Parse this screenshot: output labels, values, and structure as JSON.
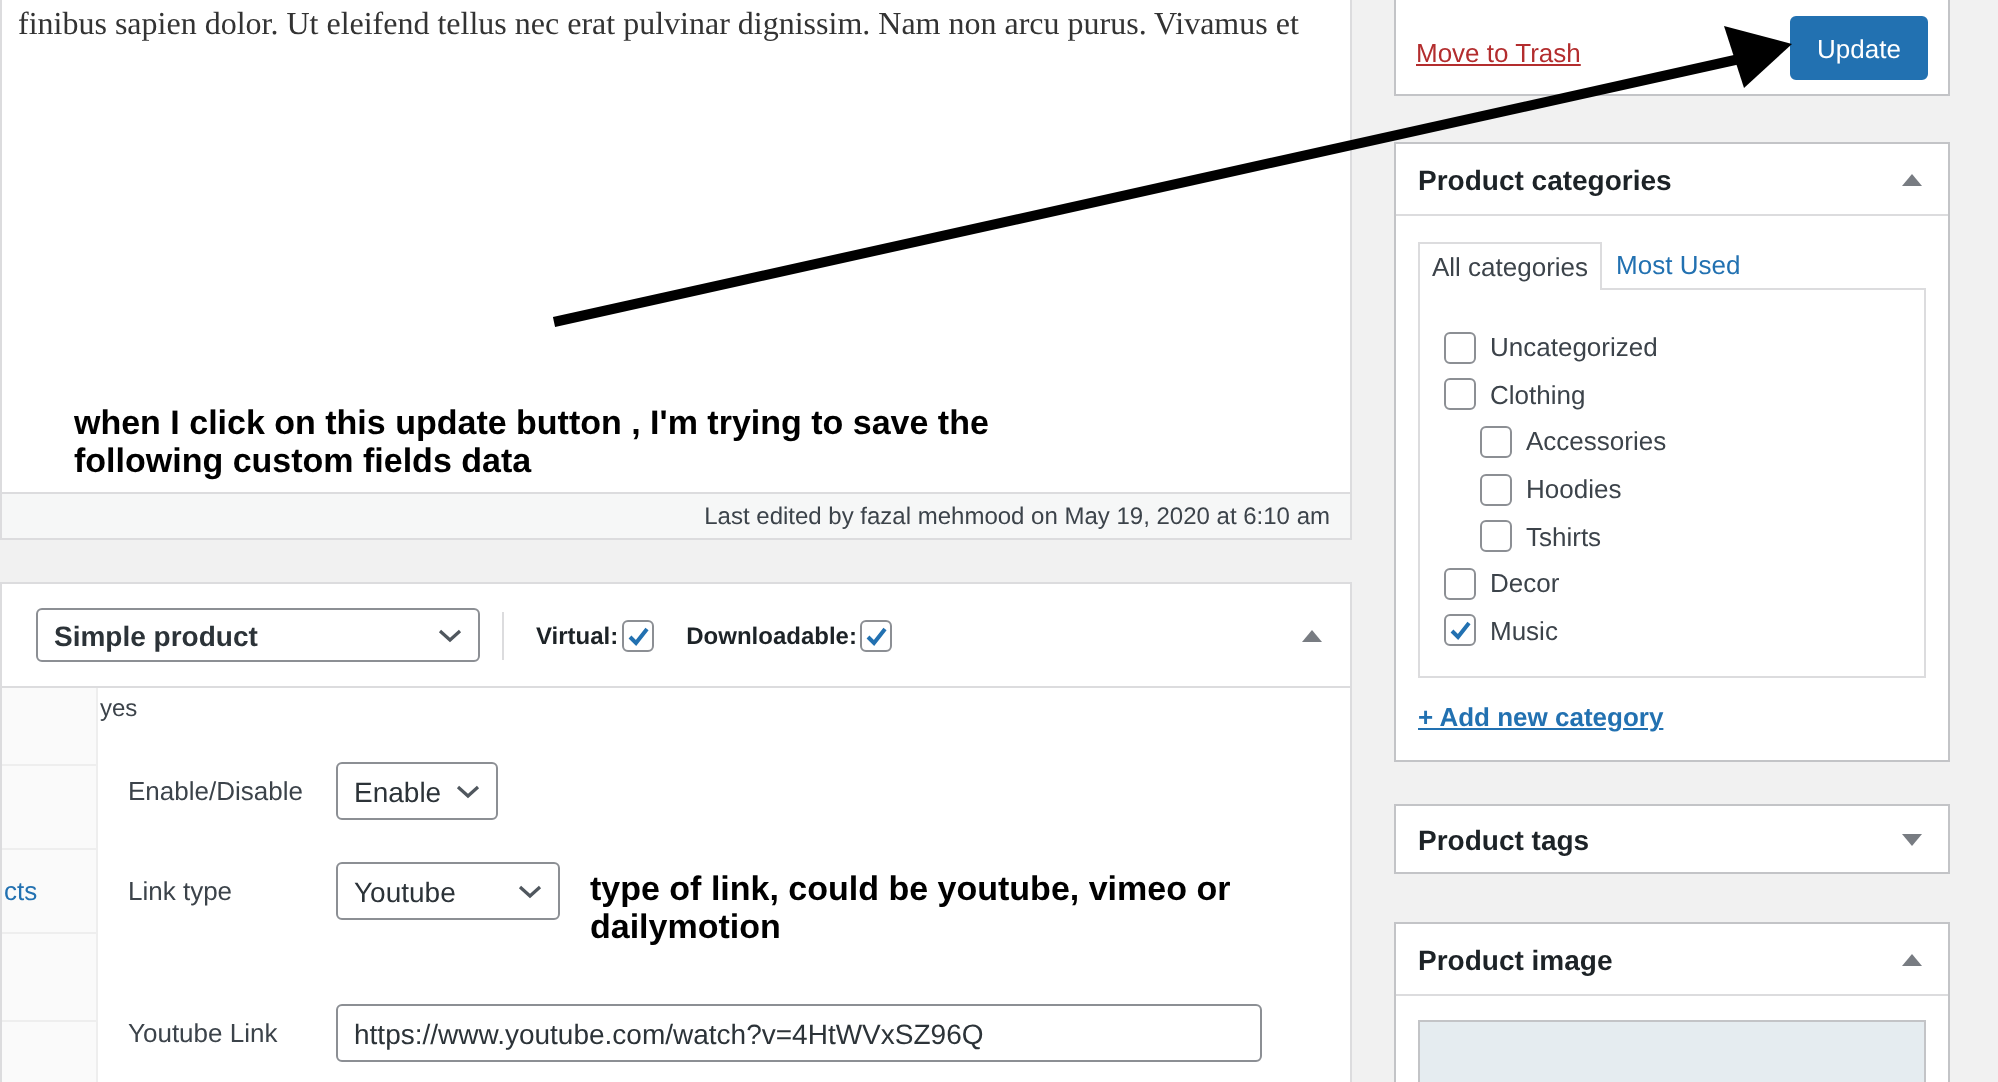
{
  "editor": {
    "text": "finibus sapien dolor. Ut eleifend tellus nec erat pulvinar dignissim. Nam non arcu purus. Vivamus et",
    "last_edited": "Last edited by fazal mehmood on May 19, 2020 at 6:10 am"
  },
  "annotations": [
    {
      "text": "when I click on this update button , I'm trying to save the following custom fields data"
    },
    {
      "text": "type of link, could be youtube, vimeo or dailymotion"
    }
  ],
  "product_data": {
    "type_select": "Simple product",
    "expanded": true,
    "options": [
      {
        "label": "Virtual:",
        "checked": true
      },
      {
        "label": "Downloadable:",
        "checked": true
      }
    ],
    "sidebar_tabs": [
      {
        "label": "cts"
      }
    ],
    "value_text": "yes",
    "fields": [
      {
        "kind": "select",
        "label": "Enable/Disable",
        "value": "Enable"
      },
      {
        "kind": "select",
        "label": "Link type",
        "value": "Youtube"
      },
      {
        "kind": "text",
        "label": "Youtube Link",
        "value": "https://www.youtube.com/watch?v=4HtWVxSZ96Q"
      }
    ]
  },
  "sidebar": {
    "publish": {
      "links": [
        {
          "kind": "trash",
          "label": "Move to Trash"
        }
      ],
      "button": "Update"
    },
    "categories": {
      "title": "Product categories",
      "expanded": true,
      "tabs": [
        {
          "label": "All categories",
          "selected": true
        },
        {
          "label": "Most Used",
          "selected": false
        }
      ],
      "items": [
        {
          "label": "Uncategorized",
          "checked": false
        },
        {
          "label": "Clothing",
          "checked": false,
          "children": [
            {
              "label": "Accessories",
              "checked": false
            },
            {
              "label": "Hoodies",
              "checked": false
            },
            {
              "label": "Tshirts",
              "checked": false
            }
          ]
        },
        {
          "label": "Decor",
          "checked": false
        },
        {
          "label": "Music",
          "checked": true
        }
      ],
      "add_link": "+ Add new category"
    },
    "tags": {
      "title": "Product tags",
      "expanded": false
    },
    "image": {
      "title": "Product image",
      "expanded": true
    }
  }
}
